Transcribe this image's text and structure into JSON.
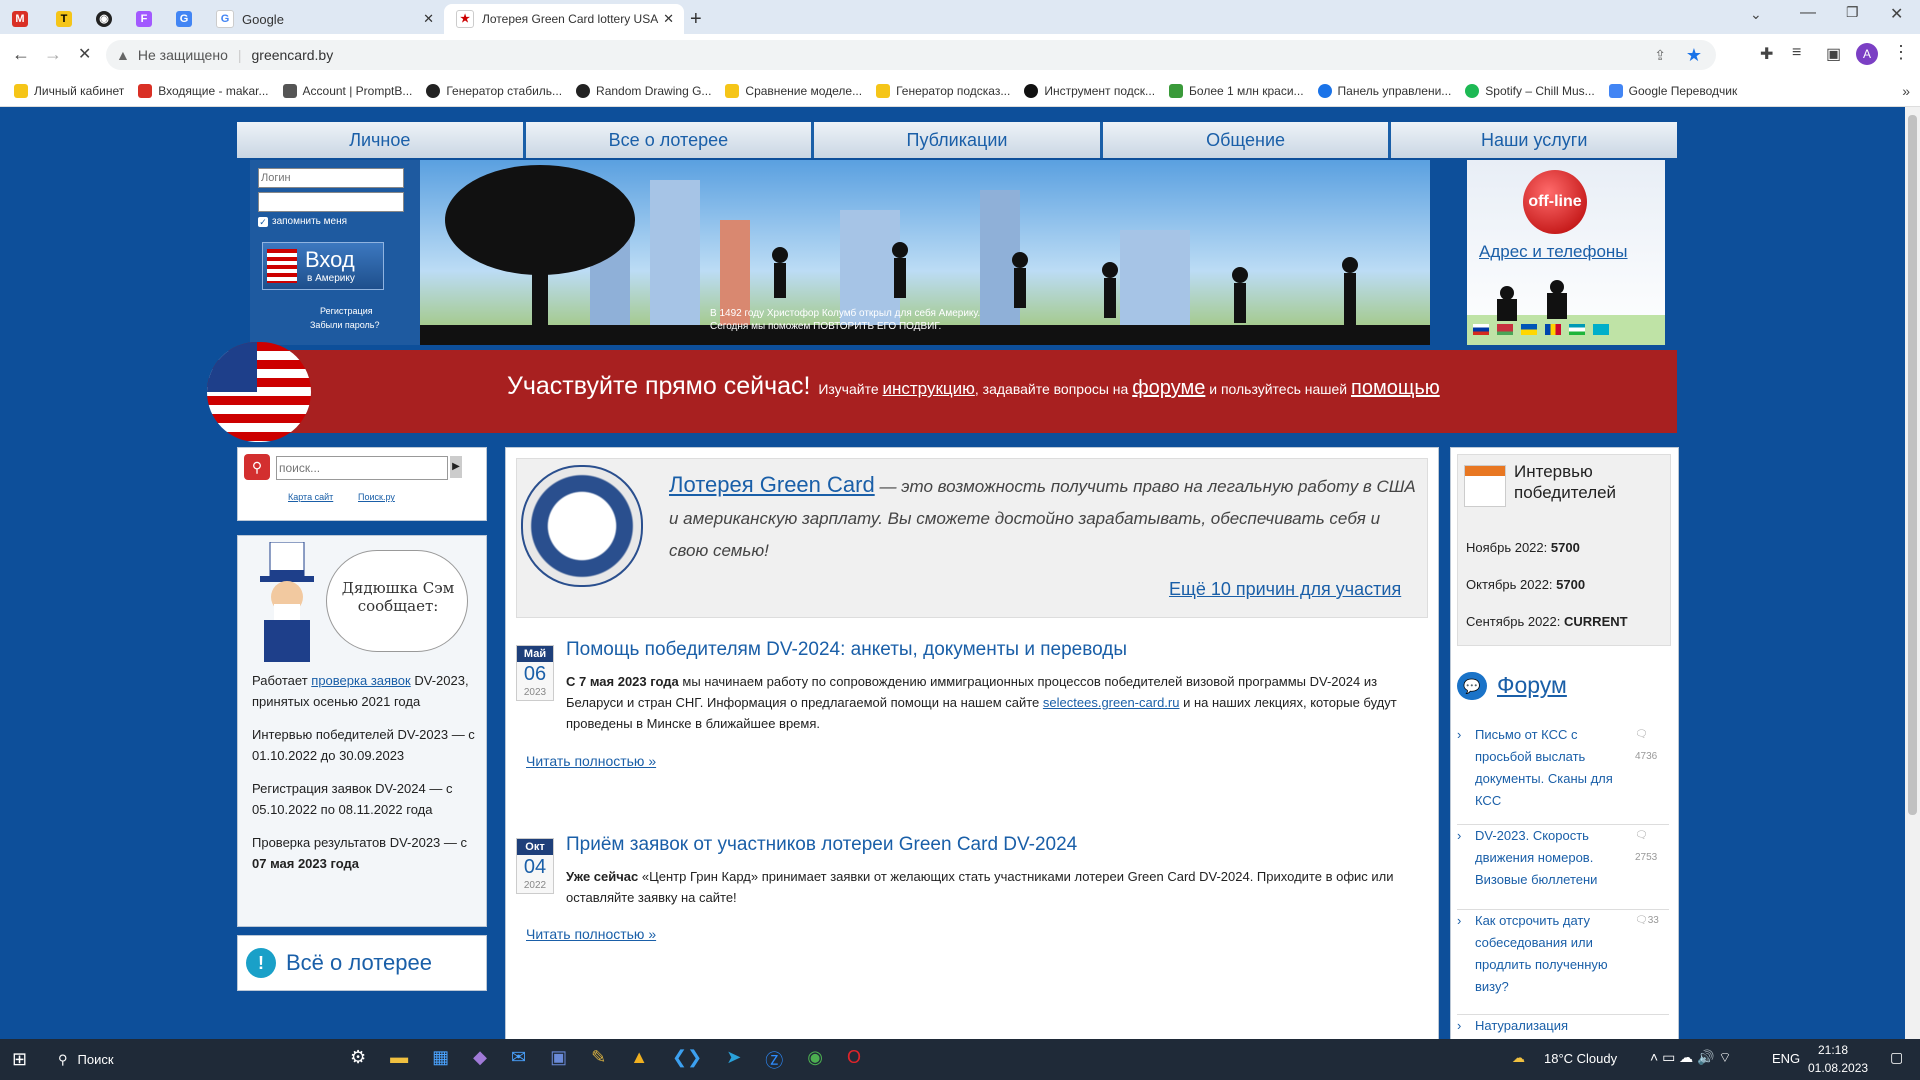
{
  "browser": {
    "tabs": [
      {
        "title": ""
      },
      {
        "title": ""
      },
      {
        "title": ""
      },
      {
        "title": ""
      },
      {
        "title": ""
      },
      {
        "title": "Google"
      },
      {
        "title": "Лотерея Green Card lottery USA"
      }
    ],
    "security_label": "Не защищено",
    "url": "greencard.by",
    "bookmarks": [
      {
        "label": "Личный кабинет",
        "color": "#f5c518"
      },
      {
        "label": "Входящие - makar...",
        "color": "#d93025"
      },
      {
        "label": "Account | PromptB...",
        "color": "#555555"
      },
      {
        "label": "Генератор стабиль...",
        "color": "#222222"
      },
      {
        "label": "Random Drawing G...",
        "color": "#222222"
      },
      {
        "label": "Сравнение моделе...",
        "color": "#f5c518"
      },
      {
        "label": "Генератор подсказ...",
        "color": "#f5c518"
      },
      {
        "label": "Инструмент подск...",
        "color": "#111111"
      },
      {
        "label": "Более 1 млн краси...",
        "color": "#3a9a3a"
      },
      {
        "label": "Панель управлени...",
        "color": "#1a73e8"
      },
      {
        "label": "Spotify – Chill Mus...",
        "color": "#1db954"
      },
      {
        "label": "Google Переводчик",
        "color": "#4285f4"
      }
    ]
  },
  "nav": {
    "items": [
      "Личное",
      "Все о лотерее",
      "Публикации",
      "Общение",
      "Наши услуги"
    ]
  },
  "login": {
    "login_placeholder": "Логин",
    "remember_label": "запомнить меня",
    "enter_label": "Вход",
    "enter_sub": "в Америку",
    "register_label": "Регистрация",
    "forgot_label": "Забыли пароль?"
  },
  "banner": {
    "line1": "В 1492 году Христофор Колумб открыл для себя Америку.",
    "line2": "Сегодня мы поможем ПОВТОРИТЬ ЕГО ПОДВИГ."
  },
  "right_header": {
    "status": "off-line",
    "address_link": "Адрес и телефоны"
  },
  "strip": {
    "headline": "Участвуйте прямо сейчас!",
    "text1": "Изучайте",
    "link1": "инструкцию",
    "text2": ", задавайте вопросы на",
    "link2": "форуме",
    "text3": "и пользуйтесь нашей",
    "link3": "помощью"
  },
  "search": {
    "placeholder": "поиск...",
    "tab1": "Карта сайт",
    "tab2": "Поиск.ру"
  },
  "uncle_sam": {
    "bubble": "Дядюшка Сэм сообщает:",
    "items": [
      {
        "pre": "Работает",
        "link": "проверка заявок",
        "post": "DV-2023, принятых осенью 2021 года",
        "bold": ""
      },
      {
        "pre": "Интервью победителей DV-2023 — с 01.10.2022 до 30.09.2023",
        "link": "",
        "post": "",
        "bold": ""
      },
      {
        "pre": "Регистрация заявок DV-2024 — с 05.10.2022 по 08.11.2022 года",
        "link": "",
        "post": "",
        "bold": ""
      },
      {
        "pre": "Проверка результатов DV-2023 — с",
        "link": "",
        "post": "",
        "bold": "07 мая 2023 года"
      }
    ]
  },
  "lottery_section": {
    "title": "Всё о лотерее"
  },
  "intro": {
    "link": "Лотерея Green Card",
    "text": "— это возможность получить право на легальную работу в США и американскую зарплату. Вы сможете достойно зарабатывать, обеспечивать себя и свою семью!",
    "more_link": "Ещё 10 причин для участия"
  },
  "posts": [
    {
      "month": "Май",
      "day": "06",
      "year": "2023",
      "title": "Помощь победителям DV-2024: анкеты, документы и переводы",
      "bold": "С 7 мая 2023 года",
      "text": "мы начинаем работу по сопровождению иммиграционных процессов победителей визовой программы DV-2024 из Беларуси и стран СНГ. Информация о предлагаемой помощи на нашем сайте",
      "link": "selectees.green-card.ru",
      "text_after": "и на наших лекциях, которые будут проведены в Минске в ближайшее время.",
      "read_more": "Читать полностью »"
    },
    {
      "month": "Окт",
      "day": "04",
      "year": "2022",
      "title": "Приём заявок от участников лотереи Green Card DV-2024",
      "bold": "Уже сейчас",
      "text": "«Центр Грин Кард» принимает заявки от желающих стать участниками лотереи Green Card DV-2024. Приходите в офис или оставляйте заявку на сайте!",
      "link": "",
      "text_after": "",
      "read_more": "Читать полностью »"
    }
  ],
  "interviews": {
    "title": "Интервью победителей",
    "rows": [
      {
        "label": "Ноябрь 2022:",
        "value": "5700"
      },
      {
        "label": "Октябрь 2022:",
        "value": "5700"
      },
      {
        "label": "Сентябрь 2022:",
        "value": "CURRENT"
      }
    ]
  },
  "forum": {
    "title": "Форум",
    "topics": [
      {
        "title": "Письмо от КСС с просьбой выслать документы. Сканы для КСС",
        "count": "4736"
      },
      {
        "title": "DV-2023. Скорость движения номеров. Визовые бюллетени",
        "count": "2753"
      },
      {
        "title": "Как отсрочить дату собеседования или продлить полученную визу?",
        "count": "33"
      },
      {
        "title": "Натурализация",
        "count": ""
      }
    ]
  },
  "taskbar": {
    "search_label": "Поиск",
    "weather": "18°C  Cloudy",
    "lang": "ENG",
    "time": "21:18",
    "date": "01.08.2023"
  }
}
